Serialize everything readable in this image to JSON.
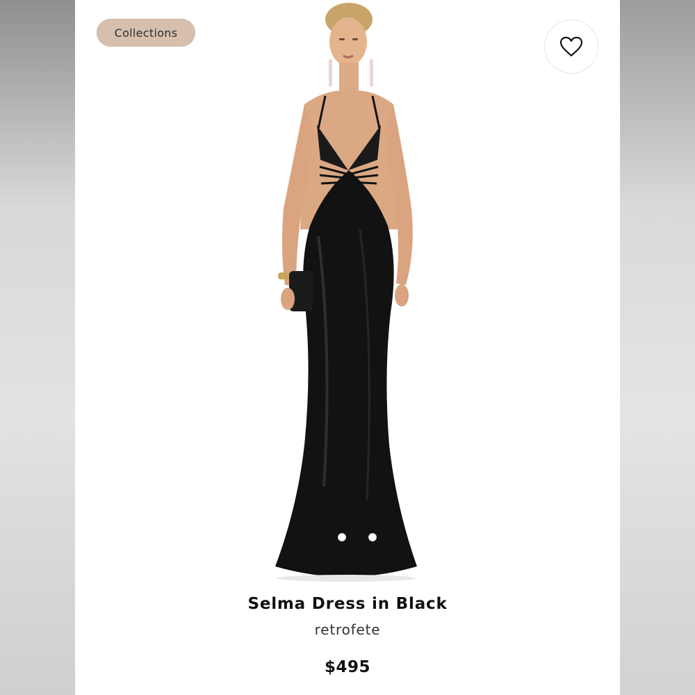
{
  "header": {
    "collections_label": "Collections",
    "favorite_icon": "heart-icon"
  },
  "carousel": {
    "image_description_icon": "product-photo",
    "dots": [
      {
        "state": "active"
      },
      {
        "state": "inactive"
      },
      {
        "state": "inactive"
      }
    ]
  },
  "product": {
    "title": "Selma Dress in Black",
    "brand": "retrofete",
    "price": "$495"
  },
  "colors": {
    "pill_bg": "#d6c0ad",
    "text_dark": "#111111",
    "card_bg": "#ffffff"
  }
}
